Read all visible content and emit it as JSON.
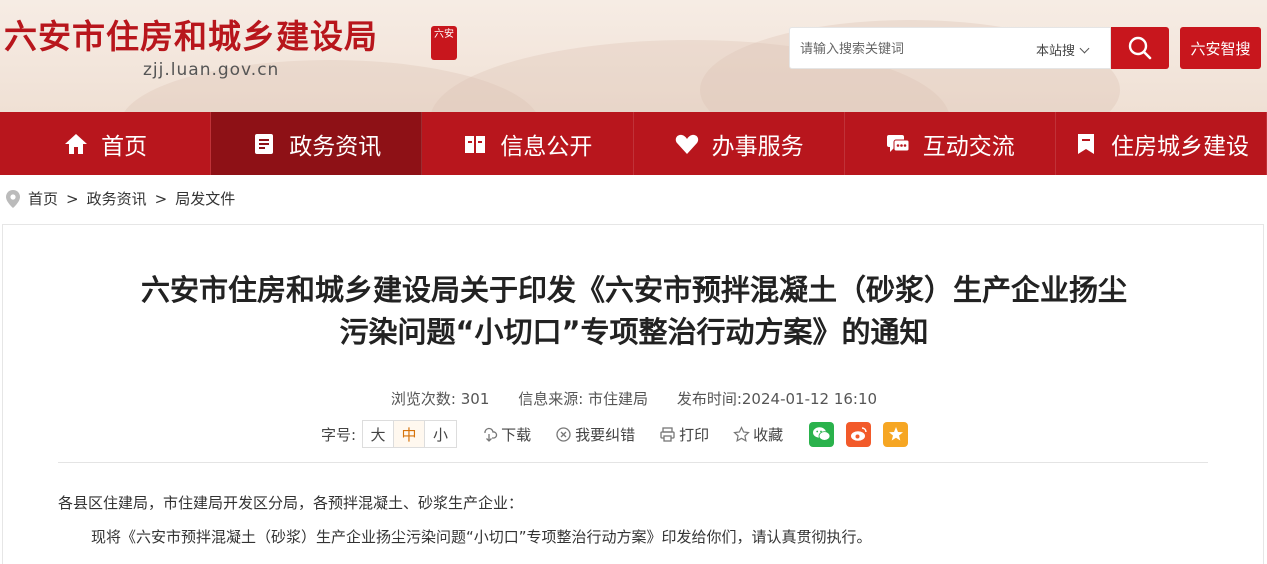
{
  "header": {
    "site_title": "六安市住房和城乡建设局",
    "seal_text": "六安",
    "domain": "zjj.luan.gov.cn",
    "search": {
      "placeholder": "请输入搜索关键词",
      "scope_label": "本站搜",
      "button_icon": "search-icon"
    },
    "smart_button_label": "六安智搜"
  },
  "nav": {
    "items": [
      {
        "label": "首页",
        "icon": "home-icon"
      },
      {
        "label": "政务资讯",
        "icon": "document-icon"
      },
      {
        "label": "信息公开",
        "icon": "book-icon"
      },
      {
        "label": "办事服务",
        "icon": "heart-icon"
      },
      {
        "label": "互动交流",
        "icon": "chat-icon"
      },
      {
        "label": "住房城乡建设",
        "icon": "bookmark-icon"
      }
    ],
    "active_index": 1
  },
  "breadcrumb": {
    "items": [
      "首页",
      "政务资讯",
      "局发文件"
    ],
    "separator": ">"
  },
  "article": {
    "title_line1": "六安市住房和城乡建设局关于印发《六安市预拌混凝土（砂浆）生产企业扬尘",
    "title_line2": "污染问题“小切口”专项整治行动方案》的通知",
    "views_label": "浏览次数:",
    "views": "301",
    "source_label": "信息来源:",
    "source": "市住建局",
    "date_label": "发布时间:",
    "date": "2024-01-12 16:10",
    "font_size_label": "字号:",
    "font_sizes": [
      "大",
      "中",
      "小"
    ],
    "active_font_size": "中",
    "download_label": "下载",
    "report_error_label": "我要纠错",
    "print_label": "打印",
    "favorite_label": "收藏",
    "paragraph1": "各县区住建局，市住建局开发区分局，各预拌混凝土、砂浆生产企业：",
    "paragraph2": "现将《六安市预拌混凝土（砂浆）生产企业扬尘污染问题“小切口”专项整治行动方案》印发给你们，请认真贯彻执行。"
  },
  "colors": {
    "brand_red": "#b8161d",
    "active_nav": "#8e1116",
    "wechat_green": "#2ab24c",
    "weibo_orange": "#f25a2a",
    "qzone_orange": "#f6a623"
  }
}
